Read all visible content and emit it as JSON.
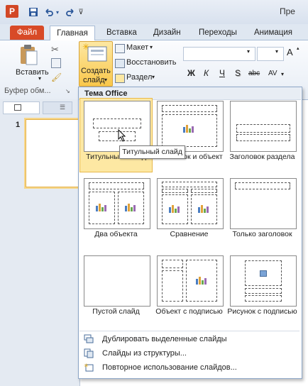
{
  "window": {
    "title": "Пре"
  },
  "tabs": [
    "Файл",
    "Главная",
    "Вставка",
    "Дизайн",
    "Переходы",
    "Анимация"
  ],
  "ribbon": {
    "paste_label": "Вставить",
    "clipboard_group": "Буфер обм...",
    "create_slide_line1": "Создать",
    "create_slide_line2": "слайд",
    "layout_label": "Макет",
    "reset_label": "Восстановить",
    "section_label": "Раздел",
    "font_buttons": [
      "Ж",
      "К",
      "Ч",
      "S",
      "abc",
      "AV"
    ]
  },
  "slides_panel": {
    "slide_number": "1"
  },
  "gallery": {
    "header": "Тема Office",
    "layouts": [
      "Титульный слайд",
      "Заголовок и объект",
      "Заголовок раздела",
      "Два объекта",
      "Сравнение",
      "Только заголовок",
      "Пустой слайд",
      "Объект с подписью",
      "Рисунок с подписью"
    ],
    "selected_index": 0
  },
  "tooltip": "Титульный слайд",
  "menu": {
    "duplicate": "Дублировать выделенные слайды",
    "from_outline": "Слайды из структуры...",
    "reuse": "Повторное использование слайдов..."
  },
  "colors": {
    "file_tab": "#d84a27",
    "selection": "#fde8a3",
    "accent": "#2b579a"
  }
}
